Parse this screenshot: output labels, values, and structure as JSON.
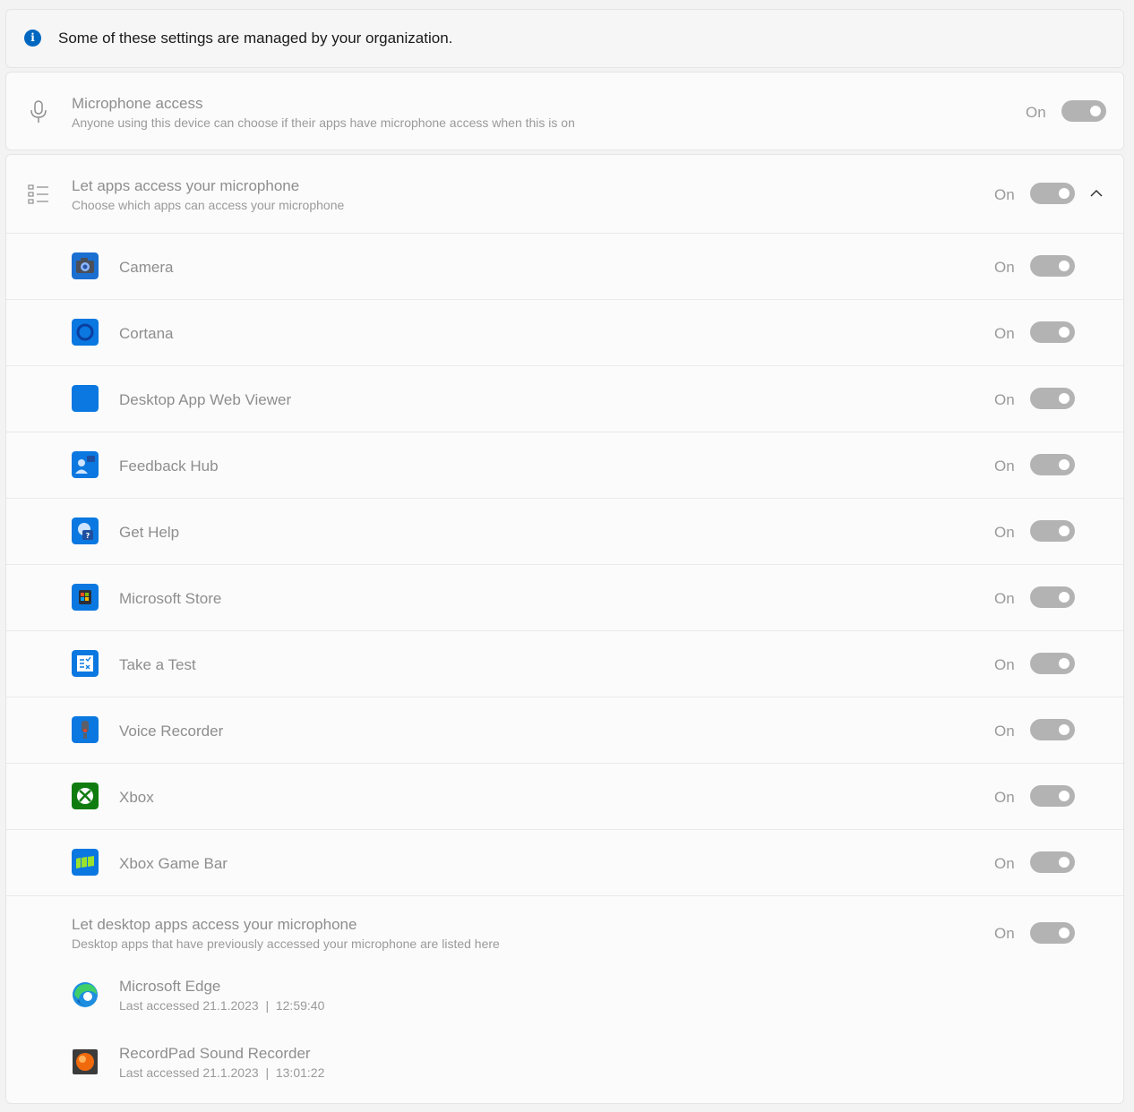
{
  "banner": {
    "text": "Some of these settings are managed by your organization.",
    "icon": "info-icon"
  },
  "microphone_access": {
    "title": "Microphone access",
    "subtitle": "Anyone using this device can choose if their apps have microphone access when this is on",
    "state": "On",
    "icon": "microphone-icon"
  },
  "let_apps": {
    "title": "Let apps access your microphone",
    "subtitle": "Choose which apps can access your microphone",
    "state": "On",
    "icon": "app-list-icon"
  },
  "apps": [
    {
      "name": "Camera",
      "state": "On",
      "icon": "camera-app-icon"
    },
    {
      "name": "Cortana",
      "state": "On",
      "icon": "cortana-app-icon"
    },
    {
      "name": "Desktop App Web Viewer",
      "state": "On",
      "icon": "web-viewer-app-icon"
    },
    {
      "name": "Feedback Hub",
      "state": "On",
      "icon": "feedback-hub-app-icon"
    },
    {
      "name": "Get Help",
      "state": "On",
      "icon": "get-help-app-icon"
    },
    {
      "name": "Microsoft Store",
      "state": "On",
      "icon": "store-app-icon"
    },
    {
      "name": "Take a Test",
      "state": "On",
      "icon": "take-a-test-app-icon"
    },
    {
      "name": "Voice Recorder",
      "state": "On",
      "icon": "voice-recorder-app-icon"
    },
    {
      "name": "Xbox",
      "state": "On",
      "icon": "xbox-app-icon"
    },
    {
      "name": "Xbox Game Bar",
      "state": "On",
      "icon": "xbox-game-bar-app-icon"
    }
  ],
  "desktop_apps": {
    "title": "Let desktop apps access your microphone",
    "subtitle": "Desktop apps that have previously accessed your microphone are listed here",
    "state": "On",
    "items": [
      {
        "name": "Microsoft Edge",
        "last_accessed": "Last accessed 21.1.2023  |  12:59:40",
        "icon": "edge-icon"
      },
      {
        "name": "RecordPad Sound Recorder",
        "last_accessed": "Last accessed 21.1.2023  |  13:01:22",
        "icon": "recordpad-icon"
      }
    ]
  },
  "colors": {
    "accent": "#0067c0",
    "toggle_disabled": "#b3b3b3",
    "text_disabled": "#8e8e8e"
  }
}
